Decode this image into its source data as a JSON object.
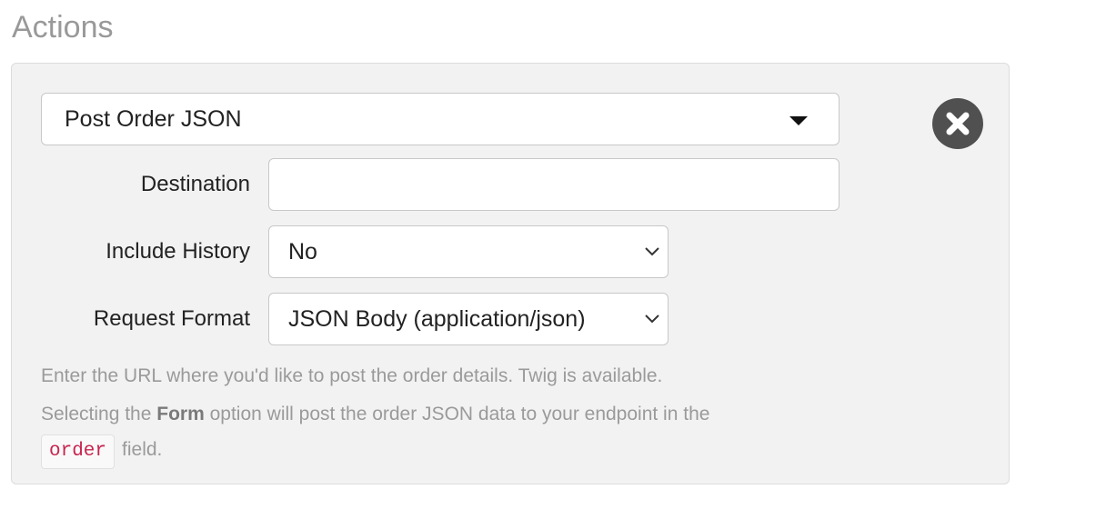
{
  "section": {
    "title": "Actions"
  },
  "action": {
    "selected": "Post Order JSON",
    "remove_icon": "close-circle-icon"
  },
  "fields": {
    "destination": {
      "label": "Destination",
      "value": "",
      "placeholder": ""
    },
    "include_history": {
      "label": "Include History",
      "selected": "No"
    },
    "request_format": {
      "label": "Request Format",
      "selected": "JSON Body (application/json)"
    }
  },
  "help": {
    "line1": "Enter the URL where you'd like to post the order details. Twig is available.",
    "line2_prefix": "Selecting the ",
    "line2_bold": "Form",
    "line2_suffix": " option will post the order JSON data to your endpoint in the",
    "code": "order",
    "line3_suffix": "field."
  },
  "colors": {
    "panel_bg": "#f2f2f2",
    "remove_button": "#505050",
    "code_text": "#c7254e",
    "muted_text": "#9a9a9a"
  }
}
